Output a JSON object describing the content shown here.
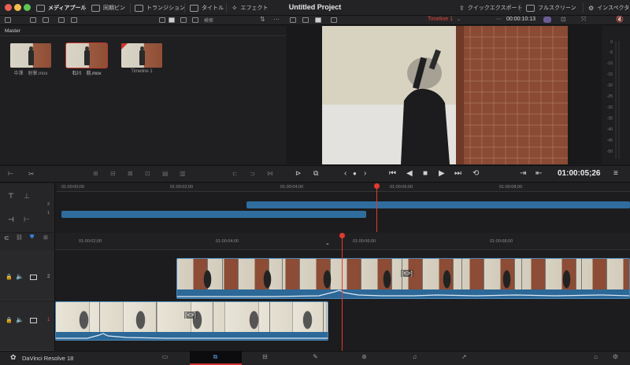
{
  "app": {
    "name": "DaVinci Resolve 18",
    "project_title": "Untitled Project"
  },
  "toolbar": {
    "media_pool": "メディアプール",
    "sync_bin": "同期ビン",
    "transitions": "トランジション",
    "titles": "タイトル",
    "effects": "エフェクト",
    "quick_export": "クイックエクスポート",
    "fullscreen": "フルスクリーン",
    "inspector": "インスペクタ"
  },
  "media_pool": {
    "search_label": "検索",
    "bin": "Master",
    "clips": [
      {
        "label": "中澤　射撃.mov",
        "selected": false
      },
      {
        "label": "石川　前.mov",
        "selected": true
      },
      {
        "label": "Timeline 1",
        "selected": false
      }
    ]
  },
  "viewer": {
    "timeline_name": "Timeline 1",
    "timecode_top": "00:00:10:13",
    "meter_ticks": [
      "0",
      "-5",
      "-10",
      "-15",
      "-20",
      "-25",
      "-30",
      "-35",
      "-40",
      "-45",
      "-50"
    ]
  },
  "transport": {
    "timecode": "01:00:05;26"
  },
  "upper_timeline": {
    "ruler": [
      "01:00:00;00",
      "01:00:02;00",
      "01:00:04;00",
      "01:00:06;00",
      "01:00:08;00"
    ],
    "tracks": [
      "2",
      "1"
    ]
  },
  "lower_timeline": {
    "ruler": [
      "01:00:02;00",
      "01:00:04;00",
      "01:00:06;00",
      "01:00:08;00"
    ],
    "tracks": [
      {
        "num": "2"
      },
      {
        "num": "1"
      }
    ],
    "clip_marker": "[<>]"
  },
  "colors": {
    "accent_red": "#e03b2e",
    "track_blue": "#2f6d9e",
    "bg": "#1c1c1e"
  }
}
